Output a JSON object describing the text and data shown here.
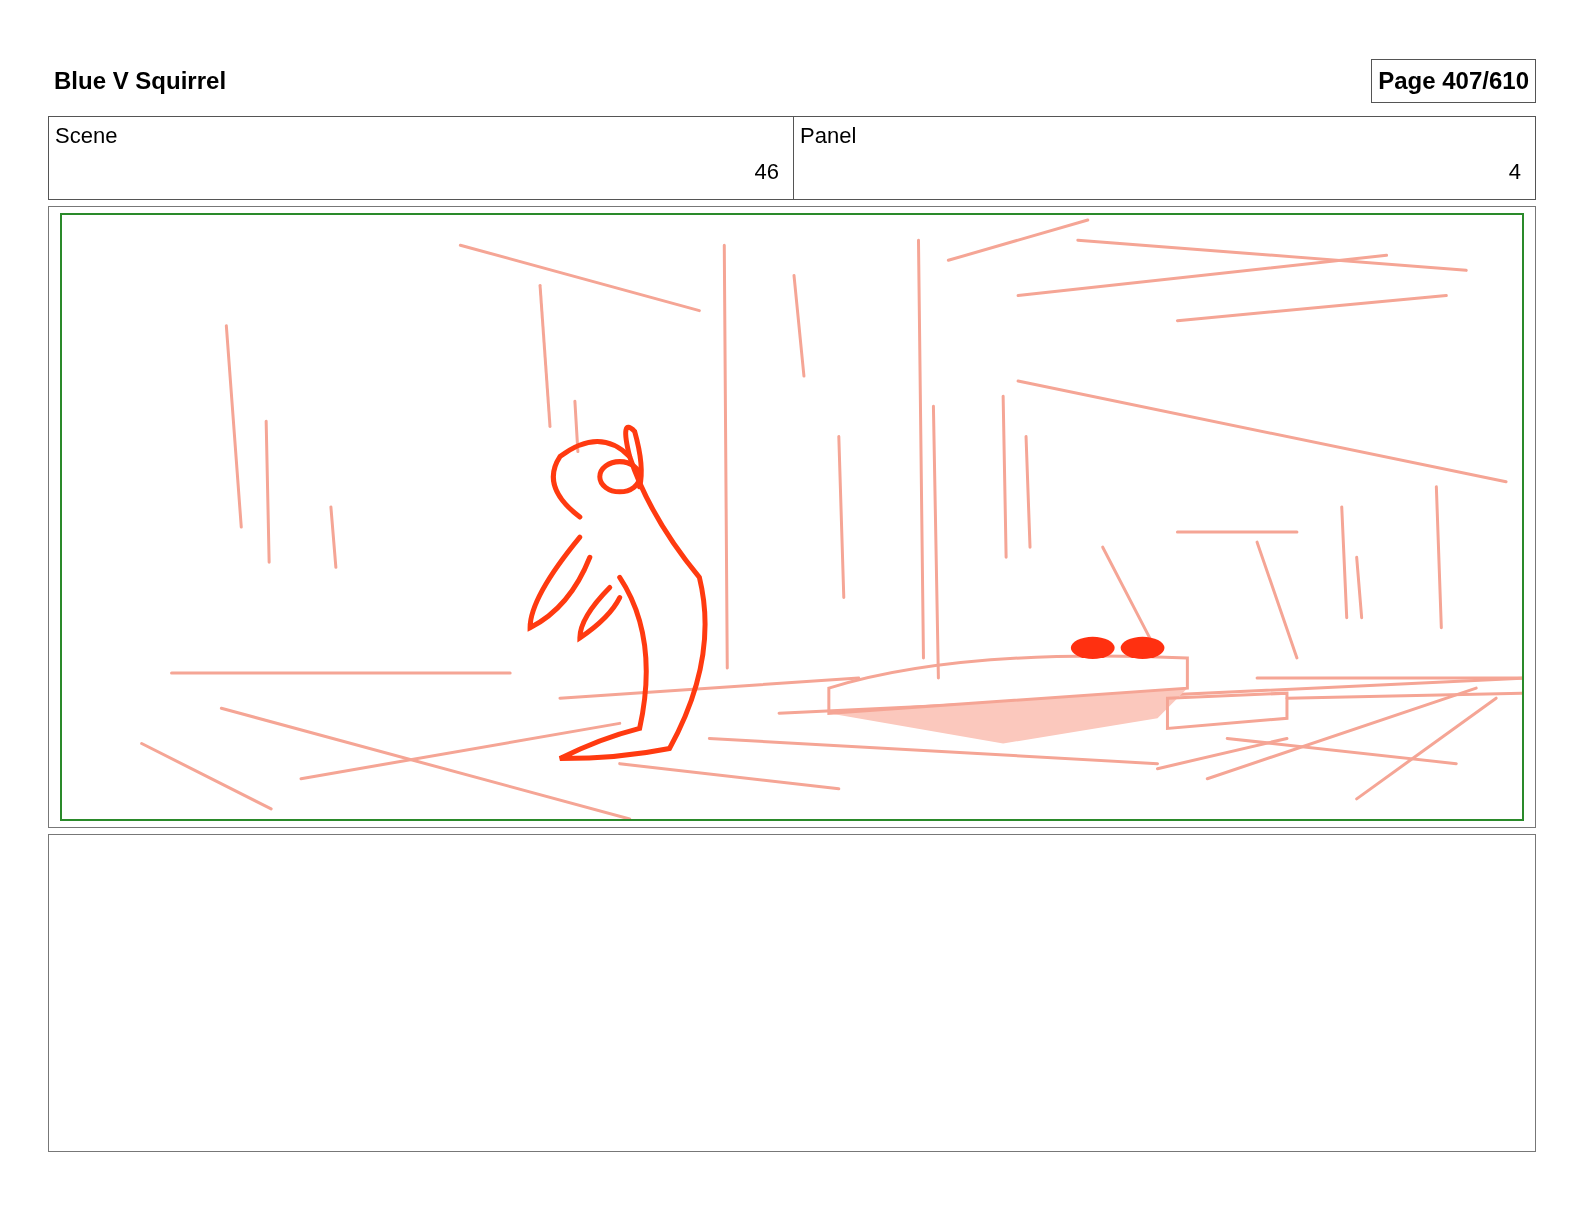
{
  "header": {
    "title": "Blue V Squirrel",
    "page": "Page 407/610"
  },
  "fields": [
    {
      "label": "Scene",
      "value": "46"
    },
    {
      "label": "Panel",
      "value": "4"
    }
  ]
}
